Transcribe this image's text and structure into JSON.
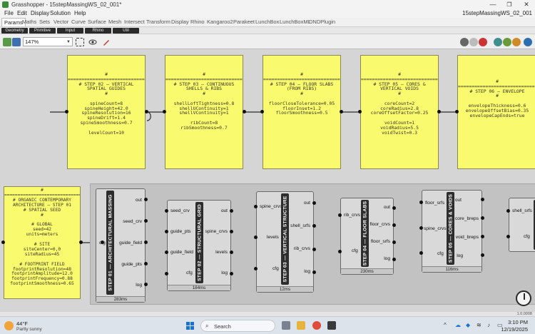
{
  "window": {
    "title": "Grasshopper - 15stepMassingWS_02_001*",
    "controls": [
      "—",
      "❐",
      "✕"
    ]
  },
  "menu": {
    "items": [
      "File",
      "Edit",
      "Display",
      "Solution",
      "Help"
    ],
    "document_name": "15stepMassingWS_02_001"
  },
  "tabs": {
    "items": [
      "Params",
      "Maths",
      "Sets",
      "Vector",
      "Curve",
      "Surface",
      "Mesh",
      "Intersect",
      "Transform",
      "Display",
      "Rhino",
      "Kangaroo2",
      "Parakeet",
      "LunchBox",
      "LunchBoxML",
      "DNDPlugin"
    ],
    "active": "Params"
  },
  "panel_groups": [
    "Geometry",
    "Primitive",
    "Input",
    "Rhino",
    "Util"
  ],
  "toolbar": {
    "zoom_value": "147%"
  },
  "panels": [
    {
      "id": "step02",
      "text": "#\n================================\n# STEP 02 — VERTICAL\nSPATIAL GUIDES\n#\n\nspineCount=8\nspineHeight=42.0\nspineResolution=16\nspineDrift=1.4\nspineSmoothness=0.7\n\nlevelCount=10"
    },
    {
      "id": "step03",
      "text": "#\n================================\n# STEP 03 — CONTINUOUS\nSHELLS & RIBS\n#\n\nshellLoftTightness=0.8\nshellUContinuity=1\nshellVContinuity=1\n\nribCount=8\nribSmoothness=0.7"
    },
    {
      "id": "step04",
      "text": "#\n================================\n# STEP 04 — FLOOR SLABS\n(FROM RIBS)\n#\n\nfloorCloseTolerance=0.05\nfloorInset=1.2\nfloorSmoothness=0.5"
    },
    {
      "id": "step05",
      "text": "#\n================================\n# STEP 05 — CORES &\nVERTICAL VOIDS\n#\n\ncoreCount=2\ncoreRadius=2.8\ncoreOffsetFactor=0.25\n\nvoidCount=1\nvoidRadius=5.5\nvoidTwist=0.3"
    },
    {
      "id": "step06",
      "text": "#\n================================\n# STEP 06 — ENVELOPE\n#\n\nenvelopeThickness=0.6\nenvelopeOffsetBias=0.35\nenvelopeCapEnds=true"
    },
    {
      "id": "step01",
      "text": "#\n================================\n# ORGANIC CONTEMPORARY\nARCHITECTURE — STEP 01\n# SPATIAL SEED\n#\n\n# GLOBAL\nseed=42\nunits=meters\n\n# SITE\nsiteCenter=0,0\nsiteRadius=45\n\n# FOOTPRINT FIELD\nfootprintResolution=48\nfootprintAmplitude=12.0\nfootprintFrequency=0.88\nfootprintSmoothness=0.65"
    }
  ],
  "clusters": [
    {
      "id": "c1",
      "name": "STEP 01 — ARCHITECTURAL MASSING",
      "inputs": [
        "cfg"
      ],
      "outputs": [
        "out",
        "seed_crv",
        "guide_field",
        "guide_pts",
        "log"
      ],
      "timing": "283ms"
    },
    {
      "id": "c2",
      "name": "STEP 02 — STRUCTURAL GRID",
      "inputs": [
        "seed_crv",
        "guide_pts",
        "guide_field",
        "cfg"
      ],
      "outputs": [
        "out",
        "spine_crvs",
        "levels",
        "log"
      ],
      "timing": "184ms"
    },
    {
      "id": "c3",
      "name": "STEP 03 — VERTICAL STRUCTURE",
      "inputs": [
        "spine_crvs",
        "levels",
        "cfg"
      ],
      "outputs": [
        "out",
        "shell_srfs",
        "rib_crvs",
        "log"
      ],
      "timing": "12ms"
    },
    {
      "id": "c4",
      "name": "STEP 04 — FLOOR SLABS",
      "inputs": [
        "rib_crvs",
        "cfg"
      ],
      "outputs": [
        "out",
        "floor_crvs",
        "floor_srfs",
        "log"
      ],
      "timing": "230ms"
    },
    {
      "id": "c5",
      "name": "STEP 05 — CORES & VOIDS",
      "inputs": [
        "floor_srfs",
        "spine_crvs",
        "cfg"
      ],
      "outputs": [
        "out",
        "core_breps",
        "void_breps",
        "log"
      ],
      "timing": "116ms"
    },
    {
      "id": "c6",
      "name": "",
      "inputs": [
        "shell_srfs",
        "cfg"
      ],
      "outputs": [],
      "timing": ""
    }
  ],
  "statusbar": {
    "version": "1.0.0008"
  },
  "taskbar": {
    "weather_temp": "44°F",
    "weather_desc": "Partly sunny",
    "search_label": "Search",
    "time": "3:10 PM",
    "date": "12/19/2025"
  },
  "colors": {
    "panel_yellow": "#fafa6e",
    "canvas_bg": "#d5d5d5",
    "cluster_bar": "#2d2d2d",
    "windows_blue": "#1a73d1"
  }
}
